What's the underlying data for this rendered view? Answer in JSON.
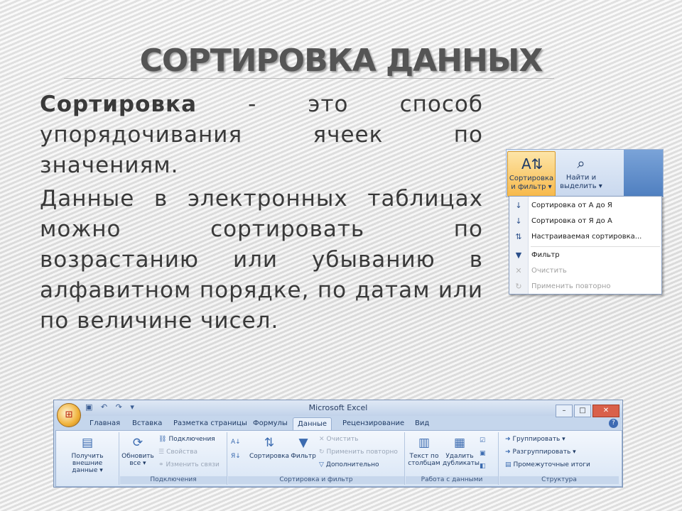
{
  "slide": {
    "title": "СОРТИРОВКА ДАННЫХ",
    "paragraph1_term": "Сортировка",
    "paragraph1_rest": " - это способ упорядочивания ячеек по значениям.",
    "paragraph2": "Данные в электронных таблицах можно сортировать по возрастанию или убыванию в алфавитном порядке, по датам или по величине чисел."
  },
  "popup": {
    "sort_filter_button": "Сортировка и фильтр ▾",
    "find_select_button": "Найти и выделить ▾",
    "menu_items": [
      {
        "label": "Сортировка от А до Я",
        "icon": "sort-az-icon",
        "enabled": true
      },
      {
        "label": "Сортировка от Я до А",
        "icon": "sort-za-icon",
        "enabled": true
      },
      {
        "label": "Настраиваемая сортировка...",
        "icon": "custom-sort-icon",
        "enabled": true
      },
      {
        "label": "Фильтр",
        "icon": "filter-icon",
        "enabled": true
      },
      {
        "label": "Очистить",
        "icon": "clear-filter-icon",
        "enabled": false
      },
      {
        "label": "Применить повторно",
        "icon": "reapply-icon",
        "enabled": false
      }
    ]
  },
  "excel": {
    "window_title": "Microsoft Excel",
    "tabs": [
      "Главная",
      "Вставка",
      "Разметка страницы",
      "Формулы",
      "Данные",
      "Рецензирование",
      "Вид"
    ],
    "active_tab": "Данные",
    "groups": {
      "external": {
        "button": "Получить внешние данные ▾"
      },
      "connections": {
        "label": "Подключения",
        "refresh": "Обновить все ▾",
        "items": [
          "Подключения",
          "Свойства",
          "Изменить связи"
        ]
      },
      "sort_filter": {
        "label": "Сортировка и фильтр",
        "sort": "Сортировка",
        "filter": "Фильтр",
        "items": [
          "Очистить",
          "Применить повторно",
          "Дополнительно"
        ]
      },
      "data_tools": {
        "label": "Работа с данными",
        "text_to_columns": "Текст по столбцам",
        "remove_duplicates": "Удалить дубликаты"
      },
      "outline": {
        "label": "Структура",
        "items": [
          "Группировать ▾",
          "Разгруппировать ▾",
          "Промежуточные итоги"
        ]
      }
    }
  }
}
